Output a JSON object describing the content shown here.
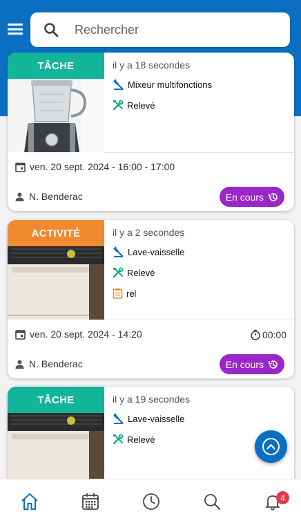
{
  "search": {
    "placeholder": "Rechercher"
  },
  "colors": {
    "primary": "#0a6fc2",
    "tache_badge": "#12b59a",
    "activite_badge": "#f08a30",
    "status_pill": "#9a27c9",
    "notification_badge": "#e23b4a"
  },
  "cards": [
    {
      "type": "TÂCHE",
      "time_ago": "il y a 18 secondes",
      "equipment": "Mixeur multifonctions",
      "intervention": "Relevé",
      "date": "ven. 20 sept. 2024 - 16:00 - 17:00",
      "person": "N. Benderac",
      "status": "En cours"
    },
    {
      "type": "ACTIVITÉ",
      "time_ago": "il y a 2 secondes",
      "equipment": "Lave-vaisselle",
      "intervention": "Relevé",
      "note": "rel",
      "date": "ven. 20 sept. 2024 - 14:20",
      "duration": "00:00",
      "person": "N. Benderac",
      "status": "En cours"
    },
    {
      "type": "TÂCHE",
      "time_ago": "il y a 19 secondes",
      "equipment": "Lave-vaisselle",
      "intervention": "Relevé"
    }
  ],
  "nav": {
    "items": [
      "home-icon",
      "calendar-icon",
      "clock-icon",
      "search-icon",
      "bell-icon"
    ],
    "active": "home-icon",
    "notification_count": "4"
  }
}
